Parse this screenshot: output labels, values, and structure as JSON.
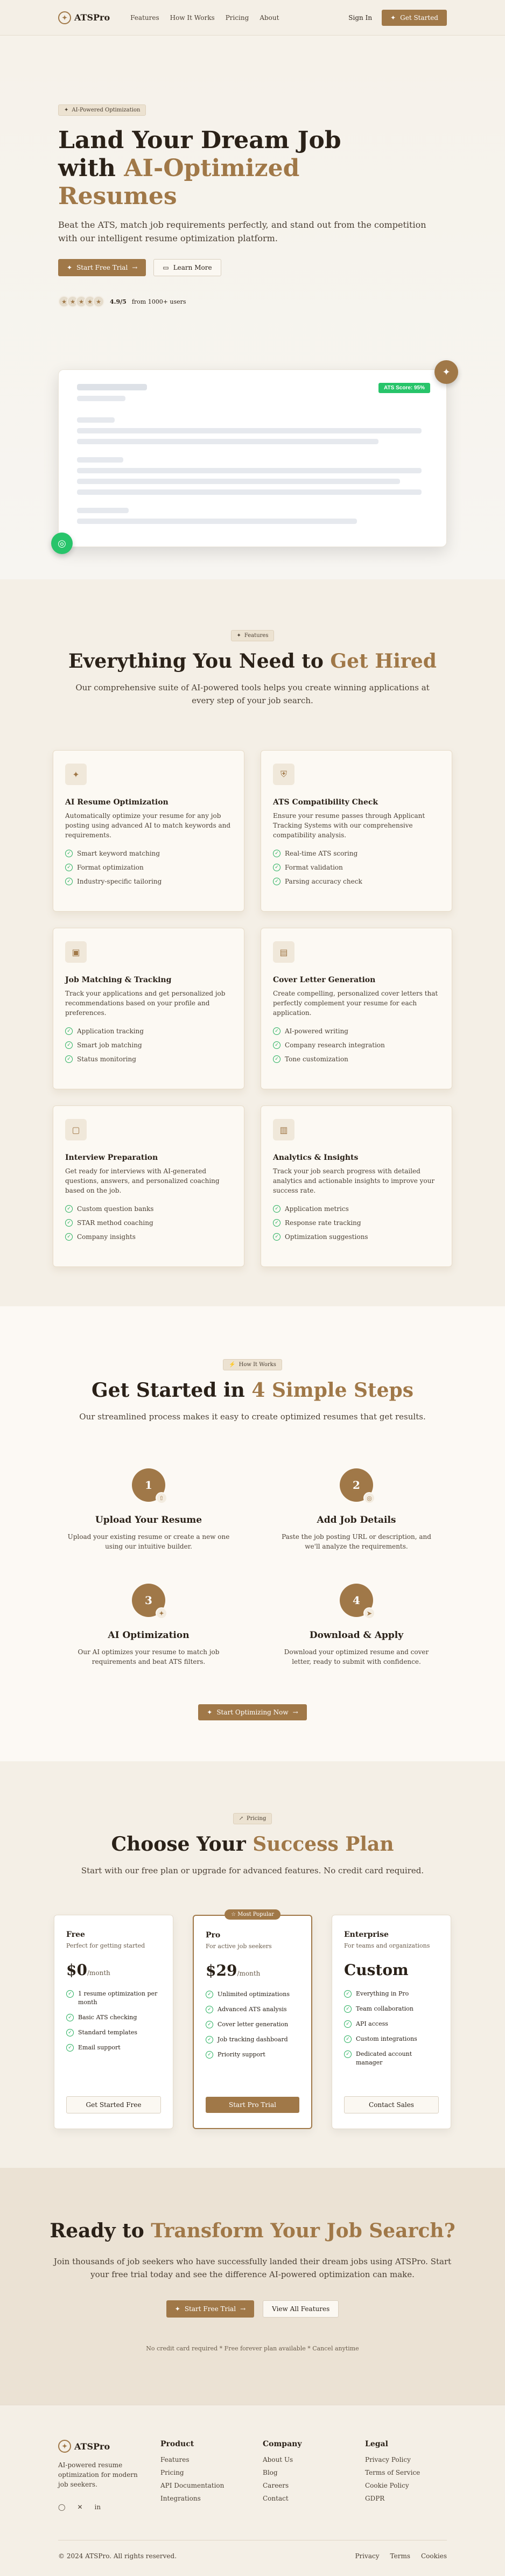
{
  "nav": {
    "brand": "ATSPro",
    "links": [
      "Features",
      "How It Works",
      "Pricing",
      "About"
    ],
    "sign_in": "Sign In",
    "get_started": "Get Started"
  },
  "hero": {
    "badge": "AI-Powered Optimization",
    "title_plain": "Land Your Dream Job with ",
    "title_accent": "AI-Optimized Resumes",
    "subtitle": "Beat the ATS, match job requirements perfectly, and stand out from the competition with our intelligent resume optimization platform.",
    "primary_cta": "Start Free Trial",
    "secondary_cta": "Learn More",
    "rating_value": "4.9/5",
    "rating_text": "from 1000+ users",
    "ats_score": "ATS Score: 95%"
  },
  "features": {
    "badge": "Features",
    "title_plain": "Everything You Need to ",
    "title_accent": "Get Hired",
    "subtitle": "Our comprehensive suite of AI-powered tools helps you create winning applications at every step of your job search.",
    "cards": [
      {
        "icon": "sparkles-icon",
        "title": "AI Resume Optimization",
        "desc": "Automatically optimize your resume for any job posting using advanced AI to match keywords and requirements.",
        "items": [
          "Smart keyword matching",
          "Format optimization",
          "Industry-specific tailoring"
        ]
      },
      {
        "icon": "shield-icon",
        "title": "ATS Compatibility Check",
        "desc": "Ensure your resume passes through Applicant Tracking Systems with our comprehensive compatibility analysis.",
        "items": [
          "Real-time ATS scoring",
          "Format validation",
          "Parsing accuracy check"
        ]
      },
      {
        "icon": "briefcase-icon",
        "title": "Job Matching & Tracking",
        "desc": "Track your applications and get personalized job recommendations based on your profile and preferences.",
        "items": [
          "Application tracking",
          "Smart job matching",
          "Status monitoring"
        ]
      },
      {
        "icon": "document-icon",
        "title": "Cover Letter Generation",
        "desc": "Create compelling, personalized cover letters that perfectly complement your resume for each application.",
        "items": [
          "AI-powered writing",
          "Company research integration",
          "Tone customization"
        ]
      },
      {
        "icon": "chat-icon",
        "title": "Interview Preparation",
        "desc": "Get ready for interviews with AI-generated questions, answers, and personalized coaching based on the job.",
        "items": [
          "Custom question banks",
          "STAR method coaching",
          "Company insights"
        ]
      },
      {
        "icon": "chart-icon",
        "title": "Analytics & Insights",
        "desc": "Track your job search progress with detailed analytics and actionable insights to improve your success rate.",
        "items": [
          "Application metrics",
          "Response rate tracking",
          "Optimization suggestions"
        ]
      }
    ]
  },
  "steps": {
    "badge": "How It Works",
    "title_plain": "Get Started in ",
    "title_accent": "4 Simple Steps",
    "subtitle": "Our streamlined process makes it easy to create optimized resumes that get results.",
    "items": [
      {
        "num": "1",
        "title": "Upload Your Resume",
        "desc": "Upload your existing resume or create a new one using our intuitive builder."
      },
      {
        "num": "2",
        "title": "Add Job Details",
        "desc": "Paste the job posting URL or description, and we'll analyze the requirements."
      },
      {
        "num": "3",
        "title": "AI Optimization",
        "desc": "Our AI optimizes your resume to match job requirements and beat ATS filters."
      },
      {
        "num": "4",
        "title": "Download & Apply",
        "desc": "Download your optimized resume and cover letter, ready to submit with confidence."
      }
    ],
    "cta": "Start Optimizing Now"
  },
  "pricing": {
    "badge": "Pricing",
    "title_plain": "Choose Your ",
    "title_accent": "Success Plan",
    "subtitle": "Start with our free plan or upgrade for advanced features. No credit card required.",
    "popular_label": "Most Popular",
    "plans": [
      {
        "name": "Free",
        "desc": "Perfect for getting started",
        "price": "$0",
        "period": "/month",
        "features": [
          "1 resume optimization per month",
          "Basic ATS checking",
          "Standard templates",
          "Email support"
        ],
        "button": "Get Started Free"
      },
      {
        "name": "Pro",
        "desc": "For active job seekers",
        "price": "$29",
        "period": "/month",
        "features": [
          "Unlimited optimizations",
          "Advanced ATS analysis",
          "Cover letter generation",
          "Job tracking dashboard",
          "Priority support"
        ],
        "button": "Start Pro Trial"
      },
      {
        "name": "Enterprise",
        "desc": "For teams and organizations",
        "price": "Custom",
        "period": "",
        "features": [
          "Everything in Pro",
          "Team collaboration",
          "API access",
          "Custom integrations",
          "Dedicated account manager"
        ],
        "button": "Contact Sales"
      }
    ]
  },
  "cta": {
    "title_plain": "Ready to ",
    "title_accent": "Transform Your Job Search?",
    "subtitle": "Join thousands of job seekers who have successfully landed their dream jobs using ATSPro. Start your free trial today and see the difference AI-powered optimization can make.",
    "primary": "Start Free Trial",
    "secondary": "View All Features",
    "fine": "No credit card required * Free forever plan available * Cancel anytime"
  },
  "footer": {
    "brand": "ATSPro",
    "blurb": "AI-powered resume optimization for modern job seekers.",
    "product_title": "Product",
    "product": [
      "Features",
      "Pricing",
      "API Documentation",
      "Integrations"
    ],
    "company_title": "Company",
    "company": [
      "About Us",
      "Blog",
      "Careers",
      "Contact"
    ],
    "legal_title": "Legal",
    "legal": [
      "Privacy Policy",
      "Terms of Service",
      "Cookie Policy",
      "GDPR"
    ],
    "copyright": "© 2024 ATSPro. All rights reserved.",
    "bottom_links": [
      "Privacy",
      "Terms",
      "Cookies"
    ]
  },
  "colors": {
    "accent": "#a07848",
    "success": "#27c46a",
    "background": "#f4efe6"
  }
}
